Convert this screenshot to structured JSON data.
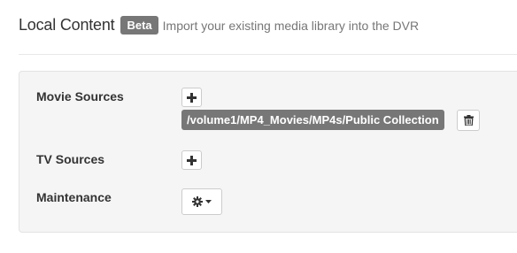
{
  "header": {
    "title": "Local Content",
    "badge": "Beta",
    "subtitle": "Import your existing media library into the DVR"
  },
  "settings": {
    "movie_sources": {
      "label": "Movie Sources",
      "add_icon": "plus-icon",
      "paths": [
        "/volume1/MP4_Movies/MP4s/Public Collection"
      ],
      "remove_icon": "trash-icon"
    },
    "tv_sources": {
      "label": "TV Sources",
      "add_icon": "plus-icon"
    },
    "maintenance": {
      "label": "Maintenance",
      "menu_icon": "gear-icon",
      "caret_icon": "caret-down-icon"
    }
  },
  "colors": {
    "badge_bg": "#777777",
    "panel_bg": "#f5f5f5",
    "text": "#333333"
  }
}
